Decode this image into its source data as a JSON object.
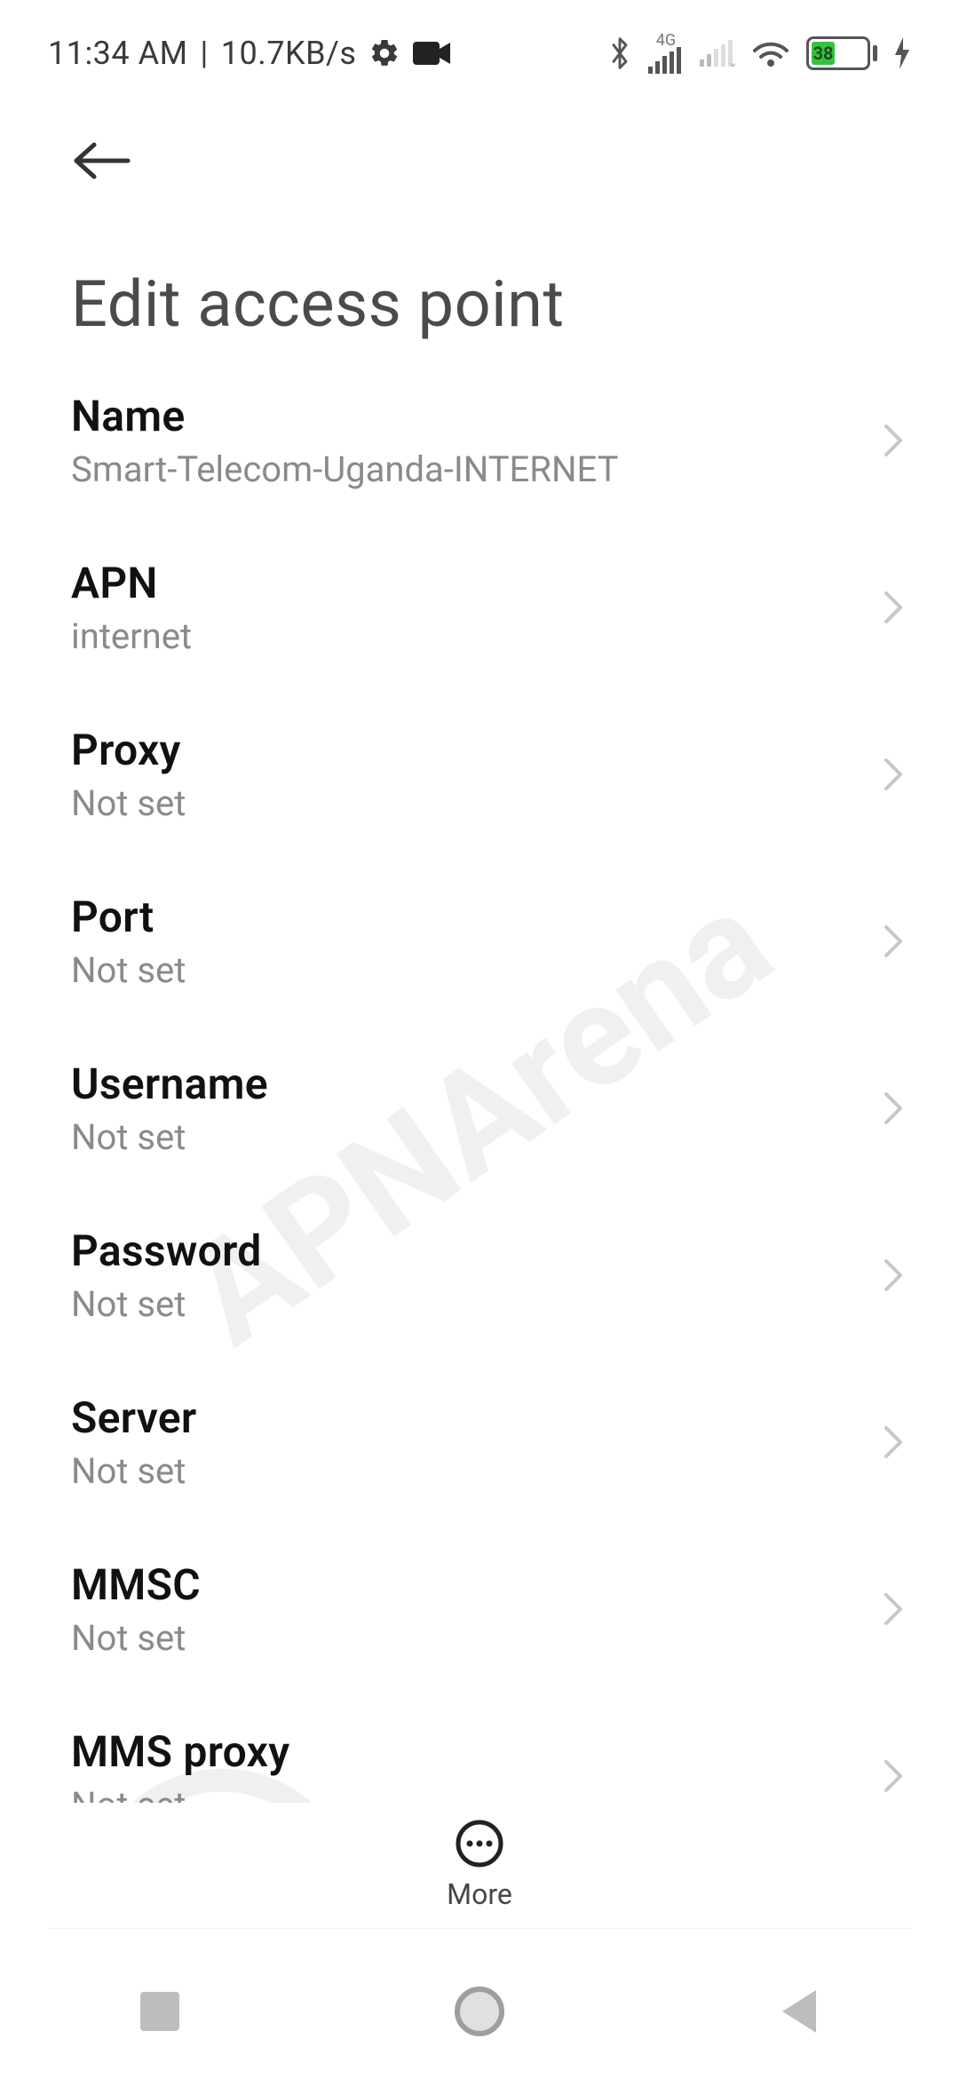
{
  "statusbar": {
    "time": "11:34 AM",
    "separator": "|",
    "net_speed": "10.7KB/s",
    "network_label": "4G",
    "battery_percent": "38"
  },
  "header": {
    "title": "Edit access point"
  },
  "rows": [
    {
      "label": "Name",
      "value": "Smart-Telecom-Uganda-INTERNET"
    },
    {
      "label": "APN",
      "value": "internet"
    },
    {
      "label": "Proxy",
      "value": "Not set"
    },
    {
      "label": "Port",
      "value": "Not set"
    },
    {
      "label": "Username",
      "value": "Not set"
    },
    {
      "label": "Password",
      "value": "Not set"
    },
    {
      "label": "Server",
      "value": "Not set"
    },
    {
      "label": "MMSC",
      "value": "Not set"
    },
    {
      "label": "MMS proxy",
      "value": "Not set"
    }
  ],
  "bottom": {
    "more_label": "More"
  },
  "watermark": {
    "text": "APNArena"
  }
}
